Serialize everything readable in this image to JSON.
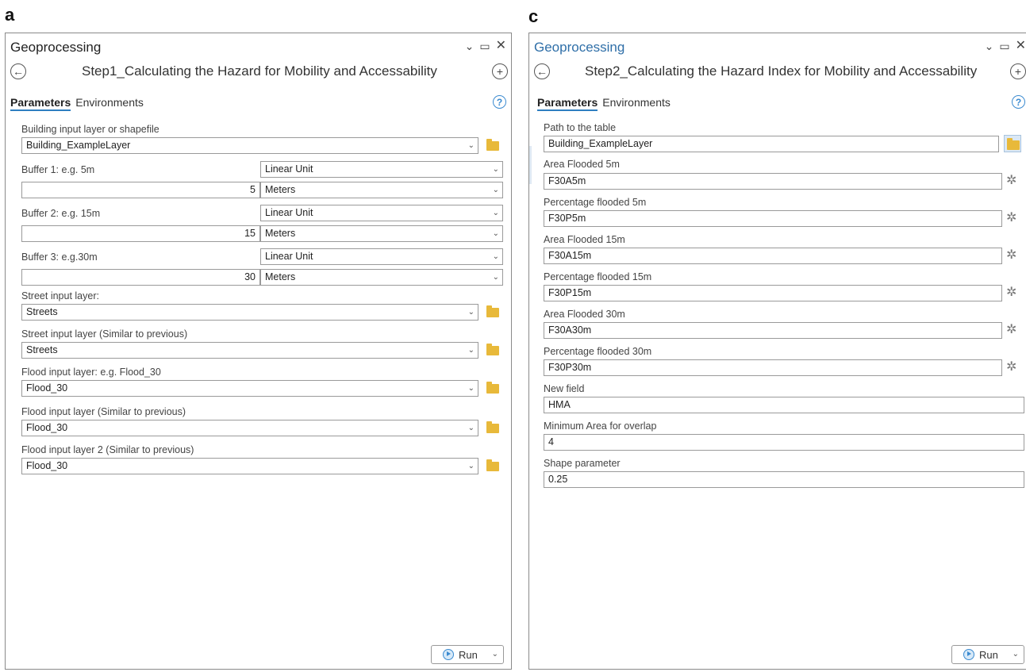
{
  "panels": {
    "a": {
      "letter": "a",
      "title": "Geoprocessing",
      "tool_title": "Step1_Calculating the Hazard for Mobility and Accessability",
      "tabs": [
        "Parameters",
        "Environments"
      ],
      "params": {
        "building_label": "Building input layer or shapefile",
        "building_value": "Building_ExampleLayer",
        "buffer1_label": "Buffer 1: e.g. 5m",
        "buffer1_type": "Linear Unit",
        "buffer1_value": "5",
        "buffer1_unit": "Meters",
        "buffer2_label": "Buffer 2: e.g. 15m",
        "buffer2_type": "Linear Unit",
        "buffer2_value": "15",
        "buffer2_unit": "Meters",
        "buffer3_label": "Buffer 3: e.g.30m",
        "buffer3_type": "Linear Unit",
        "buffer3_value": "30",
        "buffer3_unit": "Meters",
        "street_label": "Street input layer:",
        "street_value": "Streets",
        "street2_label": "Street input layer (Similar to previous)",
        "street2_value": "Streets",
        "flood_label": "Flood input layer: e.g. Flood_30",
        "flood_value": "Flood_30",
        "flood2_label": "Flood input layer (Similar to previous)",
        "flood2_value": "Flood_30",
        "flood3_label": "Flood input layer 2 (Similar to previous)",
        "flood3_value": "Flood_30"
      },
      "run_label": "Run"
    },
    "c": {
      "letter": "c",
      "title": "Geoprocessing",
      "tool_title": "Step2_Calculating the Hazard Index for Mobility and Accessability",
      "tabs": [
        "Parameters",
        "Environments"
      ],
      "params": [
        {
          "label": "Path to the table",
          "value": "Building_ExampleLayer"
        },
        {
          "label": "Area Flooded 5m",
          "value": "F30A5m"
        },
        {
          "label": "Percentage flooded 5m",
          "value": "F30P5m"
        },
        {
          "label": "Area Flooded 15m",
          "value": "F30A15m"
        },
        {
          "label": "Percentage flooded 15m",
          "value": "F30P15m"
        },
        {
          "label": "Area Flooded 30m",
          "value": "F30A30m"
        },
        {
          "label": "Percentage flooded 30m",
          "value": "F30P30m"
        },
        {
          "label": "New field",
          "value": "HMA"
        },
        {
          "label": "Minimum Area for overlap",
          "value": "4"
        },
        {
          "label": "Shape parameter",
          "value": "0.25"
        }
      ],
      "run_label": "Run"
    }
  },
  "icons": {
    "window_controls": [
      "chevron-down-icon",
      "maximize-icon",
      "close-icon"
    ],
    "back": "back-arrow-icon",
    "add": "add-icon",
    "help": "help-icon",
    "browse": "folder-icon",
    "field_picker": "gear-icon",
    "run": "play-icon"
  },
  "colors": {
    "accent": "#2f7fc1",
    "title_c": "#2f6fa8",
    "folder": "#e8b93a"
  }
}
